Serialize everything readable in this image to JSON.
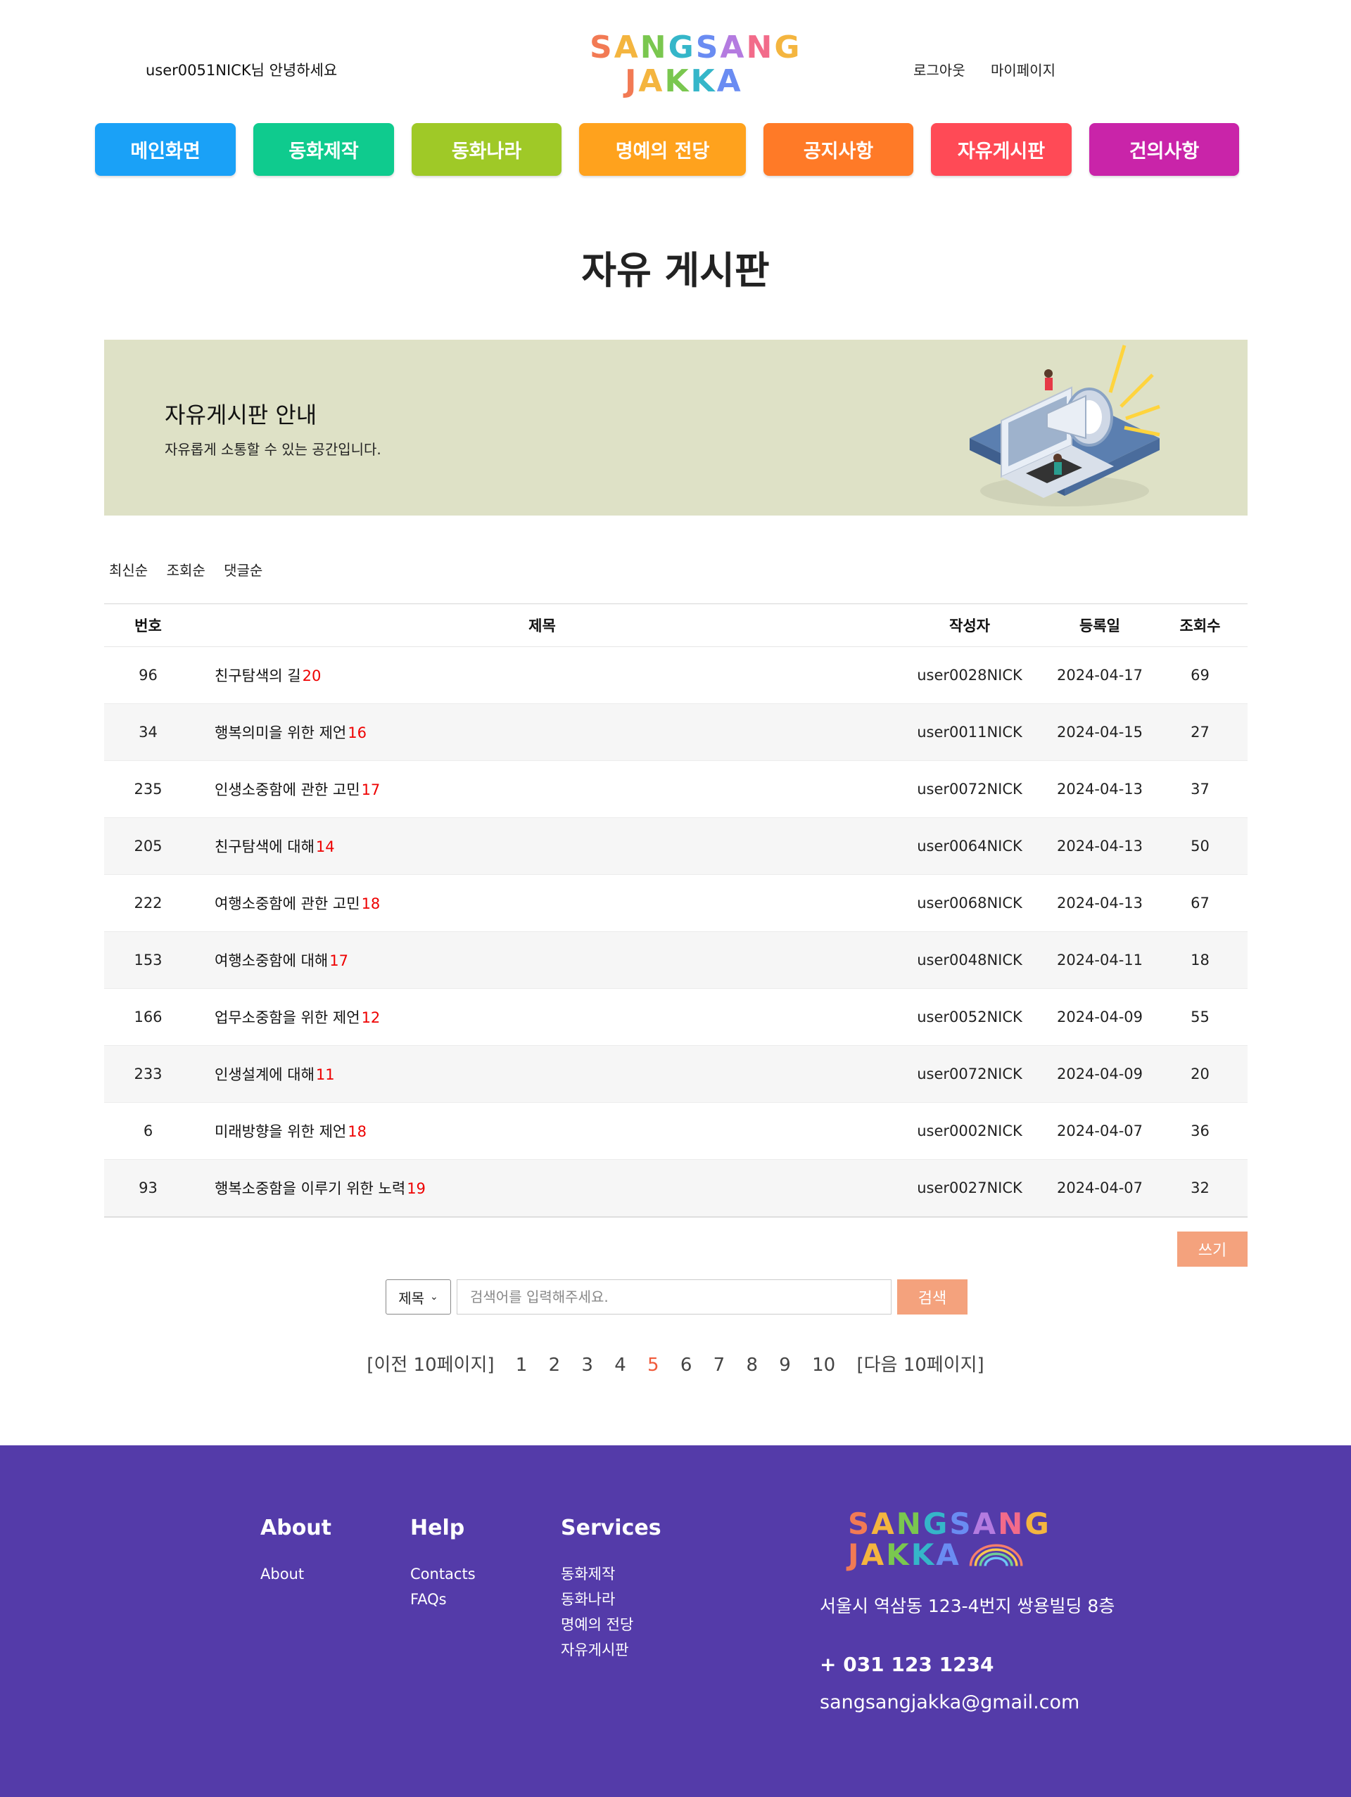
{
  "header": {
    "greeting": "user0051NICK님 안녕하세요",
    "logo_line1": "SANGSANG",
    "logo_line2": "JAKKA",
    "logout": "로그아웃",
    "mypage": "마이페이지"
  },
  "nav": [
    {
      "label": "메인화면",
      "color": "#1aa1f7"
    },
    {
      "label": "동화제작",
      "color": "#0fcb8e"
    },
    {
      "label": "동화나라",
      "color": "#9fc927"
    },
    {
      "label": "명예의 전당",
      "color": "#ffa21d"
    },
    {
      "label": "공지사항",
      "color": "#ff7a27"
    },
    {
      "label": "자유게시판",
      "color": "#ff4a56"
    },
    {
      "label": "건의사항",
      "color": "#c924a9"
    }
  ],
  "page_title": "자유 게시판",
  "banner": {
    "title": "자유게시판 안내",
    "description": "자유롭게 소통할 수 있는 공간입니다."
  },
  "sort_options": [
    "최신순",
    "조회순",
    "댓글순"
  ],
  "table": {
    "headers": {
      "num": "번호",
      "title": "제목",
      "author": "작성자",
      "date": "등록일",
      "views": "조회수"
    },
    "rows": [
      {
        "num": "96",
        "title": "친구탐색의 길",
        "comments": "20",
        "author": "user0028NICK",
        "date": "2024-04-17",
        "views": "69"
      },
      {
        "num": "34",
        "title": "행복의미을 위한 제언",
        "comments": "16",
        "author": "user0011NICK",
        "date": "2024-04-15",
        "views": "27"
      },
      {
        "num": "235",
        "title": "인생소중함에 관한 고민",
        "comments": "17",
        "author": "user0072NICK",
        "date": "2024-04-13",
        "views": "37"
      },
      {
        "num": "205",
        "title": "친구탐색에 대해",
        "comments": "14",
        "author": "user0064NICK",
        "date": "2024-04-13",
        "views": "50"
      },
      {
        "num": "222",
        "title": "여행소중함에 관한 고민",
        "comments": "18",
        "author": "user0068NICK",
        "date": "2024-04-13",
        "views": "67"
      },
      {
        "num": "153",
        "title": "여행소중함에 대해",
        "comments": "17",
        "author": "user0048NICK",
        "date": "2024-04-11",
        "views": "18"
      },
      {
        "num": "166",
        "title": "업무소중함을 위한 제언",
        "comments": "12",
        "author": "user0052NICK",
        "date": "2024-04-09",
        "views": "55"
      },
      {
        "num": "233",
        "title": "인생설계에 대해",
        "comments": "11",
        "author": "user0072NICK",
        "date": "2024-04-09",
        "views": "20"
      },
      {
        "num": "6",
        "title": "미래방향을 위한 제언",
        "comments": "18",
        "author": "user0002NICK",
        "date": "2024-04-07",
        "views": "36"
      },
      {
        "num": "93",
        "title": "행복소중함을 이루기 위한 노력",
        "comments": "19",
        "author": "user0027NICK",
        "date": "2024-04-07",
        "views": "32"
      }
    ]
  },
  "write_label": "쓰기",
  "search": {
    "select_value": "제목",
    "placeholder": "검색어를 입력해주세요.",
    "button_label": "검색"
  },
  "pagination": {
    "prev": "[이전 10페이지]",
    "pages": [
      "1",
      "2",
      "3",
      "4",
      "5",
      "6",
      "7",
      "8",
      "9",
      "10"
    ],
    "current": "5",
    "next": "[다음 10페이지]"
  },
  "footer": {
    "about_head": "About",
    "about_items": [
      "About"
    ],
    "help_head": "Help",
    "help_items": [
      "Contacts",
      "FAQs"
    ],
    "services_head": "Services",
    "services_items": [
      "동화제작",
      "동화나라",
      "명예의 전당",
      "자유게시판"
    ],
    "logo_line1": "SANGSANG",
    "logo_line2": "JAKKA",
    "address": "서울시 역삼동 123-4번지 쌍용빌딩 8층",
    "phone": "+ 031 123 1234",
    "email": "sangsangjakka@gmail.com"
  }
}
